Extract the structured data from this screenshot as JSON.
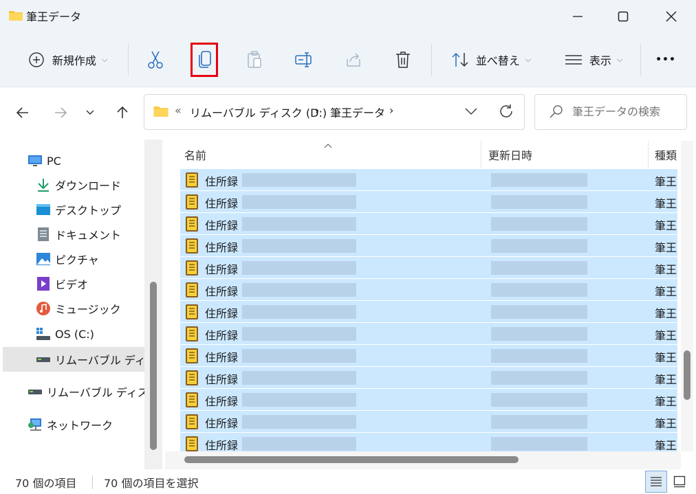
{
  "window": {
    "title": "筆王データ"
  },
  "toolbar": {
    "new_label": "新規作成",
    "sort_label": "並べ替え",
    "view_label": "表示",
    "more_label": "•••"
  },
  "address": {
    "overflow": "«",
    "crumb1": "リムーバブル ディスク (D:)",
    "sep": "›",
    "crumb2": "筆王データ"
  },
  "search": {
    "placeholder": "筆王データの検索"
  },
  "nav": {
    "pc": "PC",
    "downloads": "ダウンロード",
    "desktop": "デスクトップ",
    "documents": "ドキュメント",
    "pictures": "ピクチャ",
    "videos": "ビデオ",
    "music": "ミュージック",
    "osdrive": "OS (C:)",
    "removable_selected": "リムーバブル ディスク",
    "removable": "リムーバブル ディスク",
    "network": "ネットワーク"
  },
  "columns": {
    "name": "名前",
    "modified": "更新日時",
    "type": "種類"
  },
  "rows": [
    {
      "name": "住所録",
      "type": "筆王"
    },
    {
      "name": "住所録",
      "type": "筆王"
    },
    {
      "name": "住所録",
      "type": "筆王"
    },
    {
      "name": "住所録",
      "type": "筆王"
    },
    {
      "name": "住所録",
      "type": "筆王"
    },
    {
      "name": "住所録",
      "type": "筆王"
    },
    {
      "name": "住所録",
      "type": "筆王"
    },
    {
      "name": "住所録",
      "type": "筆王"
    },
    {
      "name": "住所録",
      "type": "筆王"
    },
    {
      "name": "住所録",
      "type": "筆王"
    },
    {
      "name": "住所録",
      "type": "筆王"
    },
    {
      "name": "住所録",
      "type": "筆王"
    },
    {
      "name": "住所録",
      "type": "筆王"
    }
  ],
  "status": {
    "count": "70 個の項目",
    "selected": "70 個の項目を選択"
  },
  "colors": {
    "accent": "#e60012",
    "selection": "#cce8ff",
    "titlebar": "#eff4f9"
  }
}
